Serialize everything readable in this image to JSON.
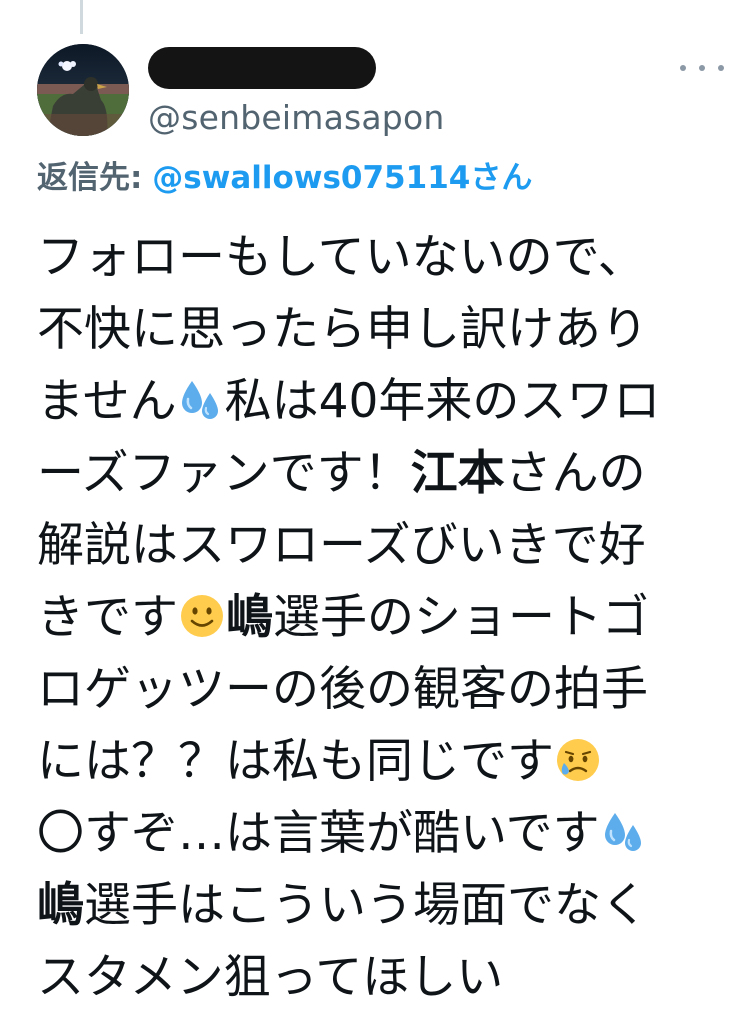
{
  "tweet": {
    "handle": "@senbeimasapon",
    "reply_label": "返信先:",
    "reply_mention": "@swallows075114さん",
    "lines": [
      [
        "フォローもしていないので、"
      ],
      [
        "不快に思ったら申し訳けあり"
      ],
      [
        "ません",
        "私は40年来のスワロ"
      ],
      [
        "ーズファンです！",
        "江本",
        "さんの"
      ],
      [
        "解説はスワローズびいきで好"
      ],
      [
        "きです",
        "嶋",
        "選手のショートゴ"
      ],
      [
        "ロゲッツーの後の観客の拍手"
      ],
      [
        "には？？は私も同じです"
      ],
      [
        "〇すぞ…は言葉が酷いです"
      ],
      [
        "嶋",
        "選手はこういう場面でなく"
      ],
      [
        "スタメン狙ってほしい"
      ]
    ]
  },
  "icons": {
    "more": "more-horizontal-icon",
    "sweat": "sweat-droplets-icon",
    "smile": "slightly-smiling-face-icon",
    "sad": "sad-but-relieved-face-icon"
  },
  "colors": {
    "link": "#1d9bf0",
    "secondary_text": "#536471",
    "primary_text": "#0f1419"
  }
}
